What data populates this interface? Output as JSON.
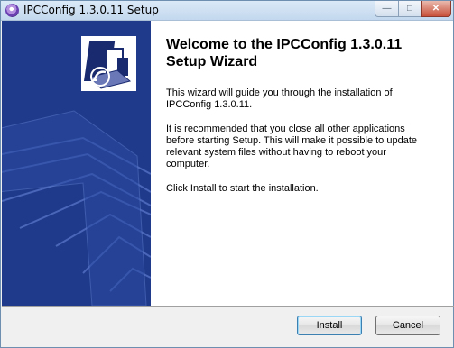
{
  "window": {
    "title": "IPCConfig 1.3.0.11 Setup"
  },
  "title_controls": {
    "minimize": "—",
    "maximize": "□",
    "close": "✕"
  },
  "main": {
    "heading": "Welcome to the IPCConfig 1.3.0.11 Setup Wizard",
    "paragraphs": [
      "This wizard will guide you through the installation of\nIPCConfig 1.3.0.11.",
      "It is recommended that you close all other applications\nbefore starting Setup. This will make it possible to update\nrelevant system files without having to reboot your\ncomputer.",
      "Click Install to start the installation."
    ]
  },
  "buttons": {
    "install": "Install",
    "cancel": "Cancel"
  },
  "colors": {
    "side_panel": "#1f3a8a",
    "content_bg": "#ffffff",
    "dialog_bg": "#f0f0f0"
  },
  "icons": {
    "app": "setup-disc-icon",
    "logo": "installer-box-icon"
  }
}
